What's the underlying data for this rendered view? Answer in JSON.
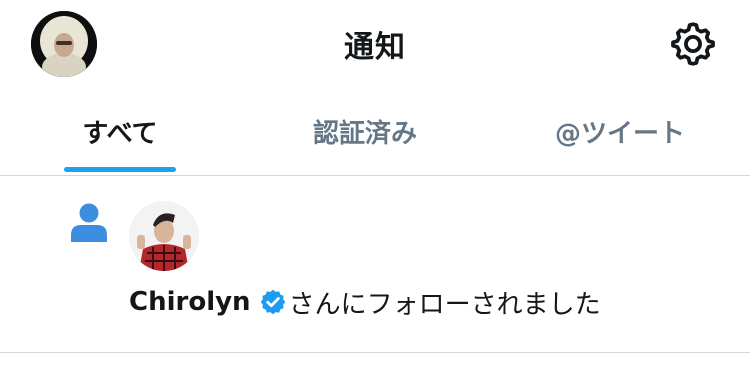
{
  "header": {
    "title": "通知",
    "avatar_icon": "user-avatar",
    "settings_icon": "gear-icon"
  },
  "tabs": [
    {
      "label": "すべて",
      "active": true
    },
    {
      "label": "認証済み",
      "active": false
    },
    {
      "label": "@ツイート",
      "active": false
    }
  ],
  "colors": {
    "accent": "#1da1f2",
    "follow_icon": "#3b8ee0",
    "verified": "#1d9bf0",
    "muted_text": "#657786",
    "divider": "#cfd9de"
  },
  "notifications": [
    {
      "type_icon": "person-icon",
      "user_name": "Chirolyn",
      "verified": true,
      "message": "さんにフォローされました"
    }
  ]
}
